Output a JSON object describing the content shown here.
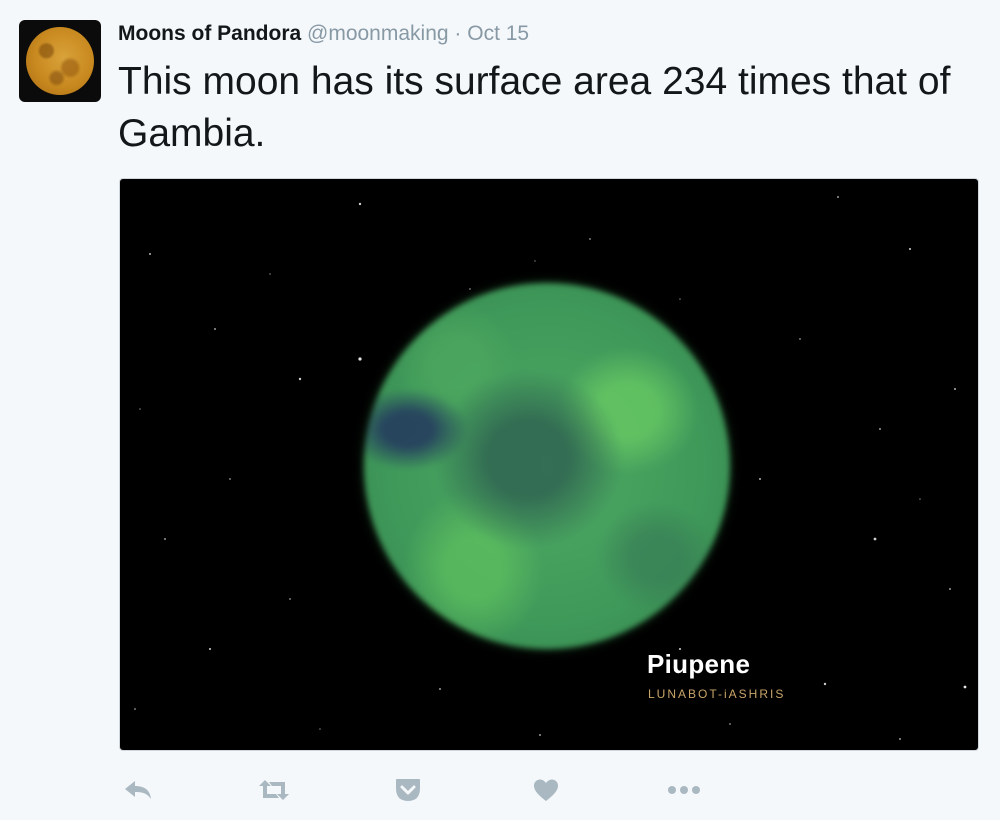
{
  "tweet": {
    "display_name": "Moons of Pandora",
    "handle": "@moonmaking",
    "separator": "·",
    "date": "Oct 15",
    "text": "This moon has its surface area 234 times that of Gambia.",
    "media": {
      "moon_name": "Piupene",
      "credit": "LUNABOT-iASHRIS"
    }
  },
  "actions": [
    {
      "icon": "reply-icon"
    },
    {
      "icon": "retweet-icon"
    },
    {
      "icon": "pocket-icon"
    },
    {
      "icon": "like-icon"
    },
    {
      "icon": "more-icon"
    }
  ],
  "colors": {
    "background": "#f5f8fa",
    "text": "#14171a",
    "muted": "#8899a6",
    "action_icon": "#aab8c2",
    "moon_green": "#4ea862",
    "credit_gold": "#c9a56a"
  }
}
